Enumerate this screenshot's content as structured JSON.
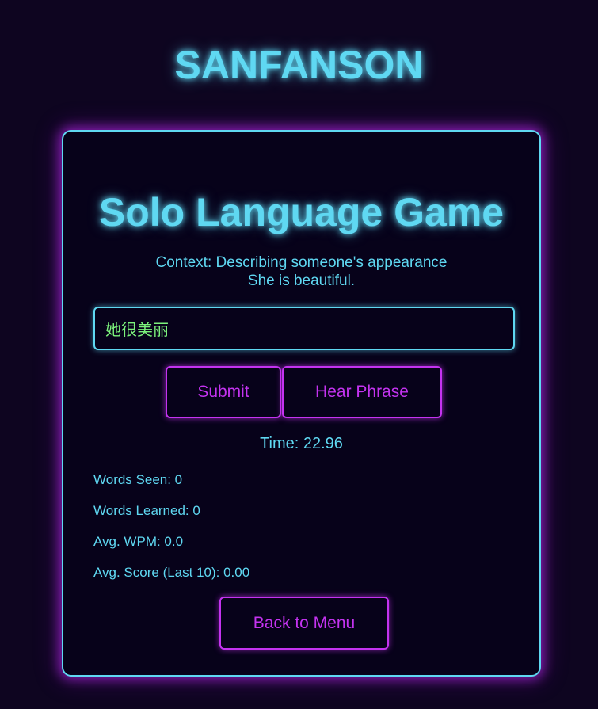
{
  "brand": "SANFANSON",
  "game": {
    "title": "Solo Language Game",
    "context": "Context: Describing someone's appearance",
    "phrase": "She is beautiful.",
    "answer_value": "她很美丽",
    "submit_label": "Submit",
    "hear_label": "Hear Phrase",
    "timer": "Time: 22.96",
    "stats": {
      "words_seen": "Words Seen: 0",
      "words_learned": "Words Learned: 0",
      "avg_wpm": "Avg. WPM: 0.0",
      "avg_score": "Avg. Score (Last 10): 0.00"
    },
    "back_label": "Back to Menu"
  },
  "colors": {
    "background": "#0e0520",
    "neon_cyan": "#5fd8f2",
    "neon_purple": "#c433f0",
    "input_text": "#7cf27c"
  }
}
